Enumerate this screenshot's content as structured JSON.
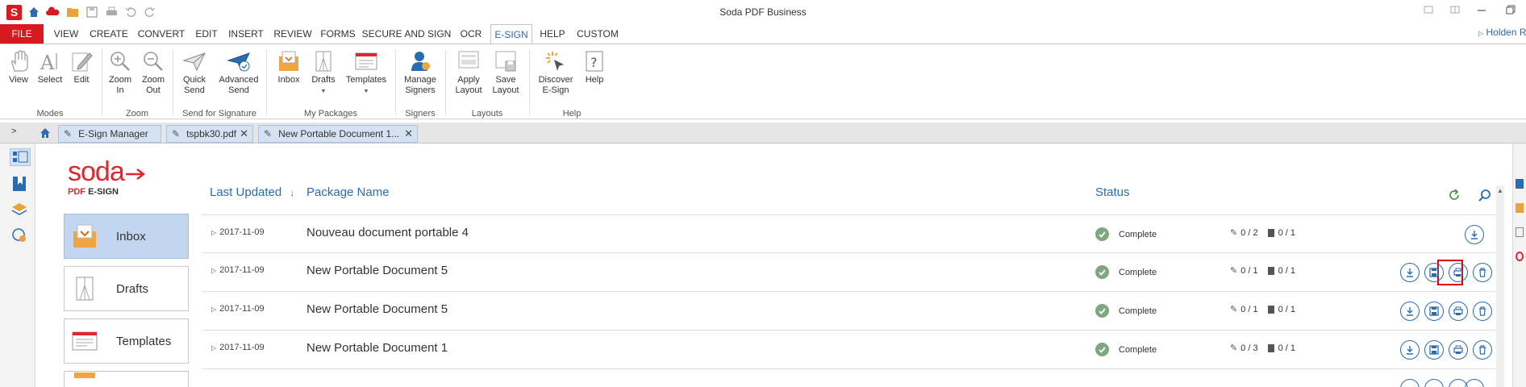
{
  "window": {
    "title": "Soda PDF Business",
    "user": "Holden R"
  },
  "menu": {
    "items": [
      "FILE",
      "VIEW",
      "CREATE",
      "CONVERT",
      "EDIT",
      "INSERT",
      "REVIEW",
      "FORMS",
      "SECURE AND SIGN",
      "OCR",
      "E-SIGN",
      "HELP",
      "CUSTOM"
    ],
    "active": "E-SIGN"
  },
  "ribbon": {
    "buttons": {
      "view": [
        "View"
      ],
      "select": [
        "Select"
      ],
      "edit": [
        "Edit"
      ],
      "zoom_in": [
        "Zoom",
        "In"
      ],
      "zoom_out": [
        "Zoom",
        "Out"
      ],
      "quick_send": [
        "Quick",
        "Send"
      ],
      "advanced_send": [
        "Advanced",
        "Send"
      ],
      "inbox": [
        "Inbox"
      ],
      "drafts": [
        "Drafts"
      ],
      "templates": [
        "Templates"
      ],
      "manage_signers": [
        "Manage",
        "Signers"
      ],
      "apply_layout": [
        "Apply",
        "Layout"
      ],
      "save_layout": [
        "Save",
        "Layout"
      ],
      "discover": [
        "Discover",
        "E-Sign"
      ],
      "help": [
        "Help"
      ]
    },
    "groups": {
      "modes": "Modes",
      "zoom": "Zoom",
      "send": "Send for Signature",
      "packages": "My Packages",
      "signers": "Signers",
      "layouts": "Layouts",
      "help": "Help"
    }
  },
  "tabs": [
    {
      "label": "E-Sign Manager"
    },
    {
      "label": "tspbk30.pdf"
    },
    {
      "label": "New Portable Document 1..."
    }
  ],
  "logo": {
    "word": "soda",
    "pdf": "PDF",
    "esign": "E-SIGN"
  },
  "sidebar": {
    "inbox": "Inbox",
    "drafts": "Drafts",
    "templates": "Templates"
  },
  "table": {
    "headers": {
      "last_updated": "Last Updated",
      "package_name": "Package Name",
      "status": "Status"
    },
    "rows": [
      {
        "date": "2017-11-09",
        "name": "Nouveau document portable 4",
        "status": "Complete",
        "signed": "0 / 2",
        "docs": "0 / 1"
      },
      {
        "date": "2017-11-09",
        "name": "New Portable Document 5",
        "status": "Complete",
        "signed": "0 / 1",
        "docs": "0 / 1"
      },
      {
        "date": "2017-11-09",
        "name": "New Portable Document 5",
        "status": "Complete",
        "signed": "0 / 1",
        "docs": "0 / 1"
      },
      {
        "date": "2017-11-09",
        "name": "New Portable Document 1",
        "status": "Complete",
        "signed": "0 / 3",
        "docs": "0 / 1"
      }
    ]
  },
  "colors": {
    "brand_red": "#d71920",
    "accent_blue": "#2b6cb0",
    "complete_green": "#7ea87e",
    "highlight_red": "#e00000"
  }
}
